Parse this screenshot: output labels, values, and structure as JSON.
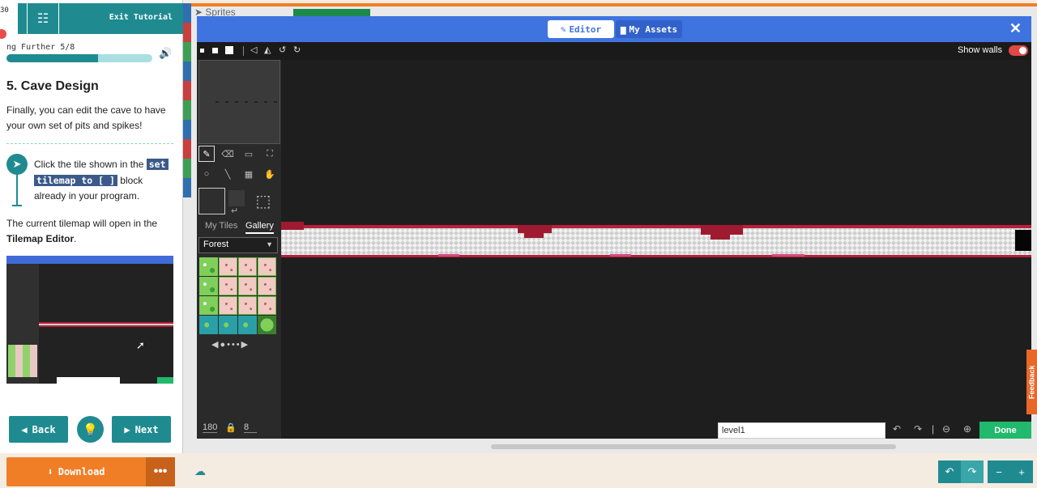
{
  "tutorial": {
    "time_fragment": "30",
    "exit_label": "Exit Tutorial",
    "progress_label": "ng Further 5/8",
    "progress_fraction": 0.625,
    "title": "5. Cave Design",
    "intro": "Finally, you can edit the cave to have your own set of pits and spikes!",
    "step": {
      "before": "Click the tile shown in the ",
      "code1": "set",
      "code2": "tilemap to [ ]",
      "after": " block already in your program."
    },
    "after_text_1": "The current tilemap will open in the ",
    "after_text_bold": "Tilemap Editor",
    "after_text_2": ".",
    "back_label": "Back",
    "next_label": "Next"
  },
  "background": {
    "sprites_label": "Sprites"
  },
  "modal": {
    "tab_editor": "Editor",
    "tab_assets": "My Assets",
    "show_walls_label": "Show walls",
    "show_walls_on": true,
    "tab_mytiles": "My Tiles",
    "tab_gallery": "Gallery",
    "gallery_category": "Forest",
    "tiles": [
      "g",
      "p",
      "p",
      "p",
      "g",
      "p",
      "p",
      "p",
      "g",
      "p",
      "p",
      "p",
      "w",
      "w",
      "w",
      "b"
    ],
    "pager": "◀●•••▶",
    "width_value": "180",
    "height_value": "8",
    "level_name": "level1",
    "done_label": "Done"
  },
  "feedback_label": "Feedback",
  "bottom": {
    "download_label": "Download",
    "more_label": "•••"
  },
  "colors": {
    "teal": "#1f8b91",
    "blue": "#3f73df",
    "orange": "#f07e26",
    "green": "#21b96b",
    "pit_red": "#9e1a30"
  }
}
